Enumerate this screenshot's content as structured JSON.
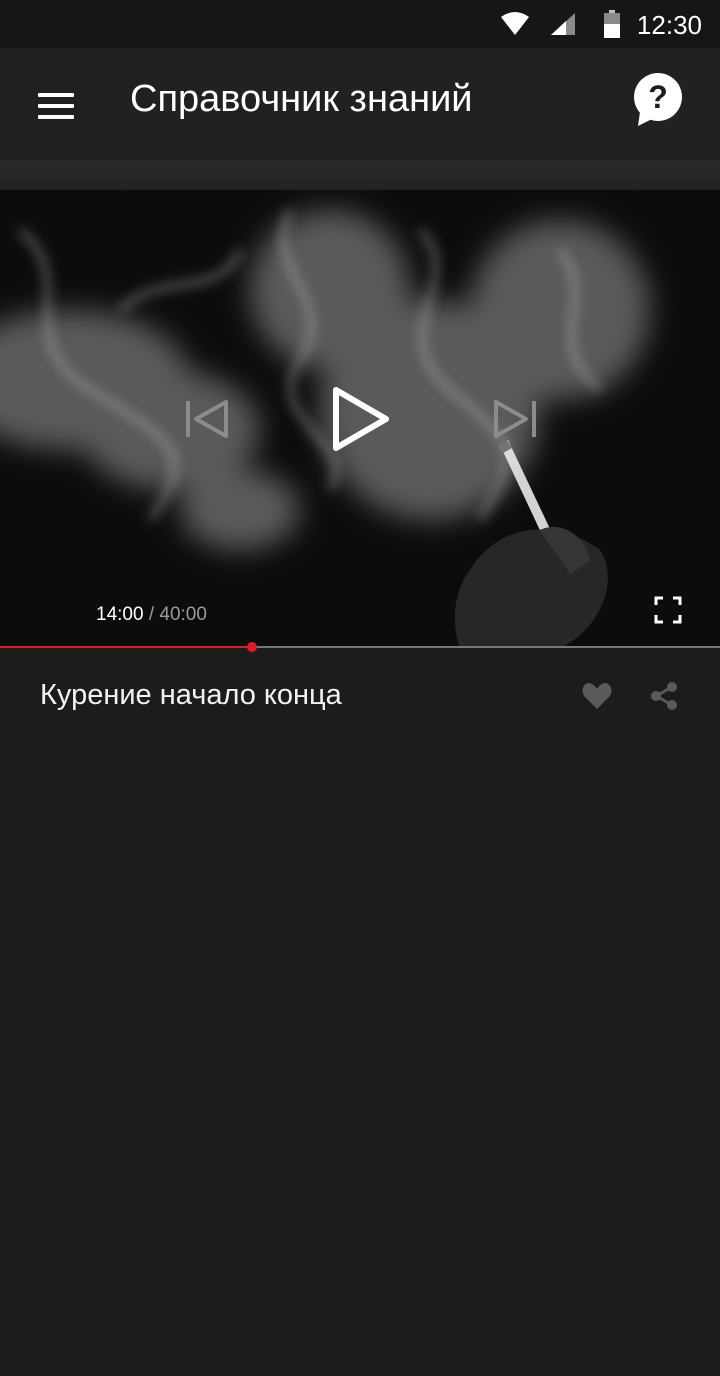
{
  "status_bar": {
    "time": "12:30",
    "icons": [
      "wifi-icon",
      "signal-icon",
      "battery-icon"
    ]
  },
  "app_bar": {
    "title": "Справочник знаний",
    "icons": [
      "hamburger-menu-icon",
      "help-bubble-icon"
    ]
  },
  "player": {
    "current_time": "14:00",
    "separator": " / ",
    "total_time": "40:00",
    "progress": 0.35,
    "icons": [
      "skip-previous-icon",
      "play-icon",
      "skip-next-icon",
      "fullscreen-icon"
    ]
  },
  "video": {
    "title": "Курение начало конца",
    "icons": [
      "heart-icon",
      "share-icon"
    ]
  },
  "colors": {
    "background": "#1c1c1c",
    "app_bar": "#212121",
    "status_bar": "#161616",
    "accent": "#e01b24",
    "muted_icon": "#5a5a5a"
  }
}
